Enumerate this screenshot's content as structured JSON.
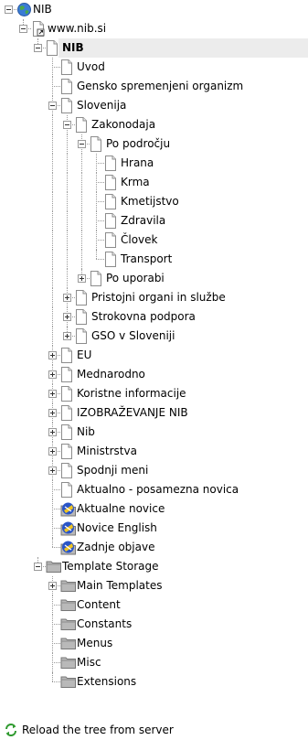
{
  "tree": [
    {
      "label": "NIB",
      "depth": 0,
      "exp": "minus",
      "icon": "globe-icon",
      "last": true
    },
    {
      "label": "www.nib.si",
      "depth": 1,
      "exp": "minus",
      "icon": "shortcut-page-icon",
      "last": true
    },
    {
      "label": "NIB",
      "depth": 2,
      "exp": "minus",
      "icon": "page-icon",
      "last": true,
      "bold": true,
      "selected": true
    },
    {
      "label": "Uvod",
      "depth": 3,
      "exp": "none",
      "icon": "page-icon",
      "last": false
    },
    {
      "label": "Gensko spremenjeni organizm",
      "depth": 3,
      "exp": "none",
      "icon": "page-icon",
      "last": false
    },
    {
      "label": "Slovenija",
      "depth": 3,
      "exp": "minus",
      "icon": "page-icon",
      "last": false
    },
    {
      "label": "Zakonodaja",
      "depth": 4,
      "exp": "minus",
      "icon": "page-icon",
      "last": false
    },
    {
      "label": "Po področju",
      "depth": 5,
      "exp": "minus",
      "icon": "page-icon",
      "last": false
    },
    {
      "label": "Hrana",
      "depth": 6,
      "exp": "none",
      "icon": "page-icon",
      "last": false
    },
    {
      "label": "Krma",
      "depth": 6,
      "exp": "none",
      "icon": "page-icon",
      "last": false
    },
    {
      "label": "Kmetijstvo",
      "depth": 6,
      "exp": "none",
      "icon": "page-icon",
      "last": false
    },
    {
      "label": "Zdravila",
      "depth": 6,
      "exp": "none",
      "icon": "page-icon",
      "last": false
    },
    {
      "label": "Človek",
      "depth": 6,
      "exp": "none",
      "icon": "page-icon",
      "last": false
    },
    {
      "label": "Transport",
      "depth": 6,
      "exp": "none",
      "icon": "page-icon",
      "last": true
    },
    {
      "label": "Po uporabi",
      "depth": 5,
      "exp": "plus",
      "icon": "page-icon",
      "last": true
    },
    {
      "label": "Pristojni organi in službe",
      "depth": 4,
      "exp": "plus",
      "icon": "page-icon",
      "last": false
    },
    {
      "label": "Strokovna podpora",
      "depth": 4,
      "exp": "plus",
      "icon": "page-icon",
      "last": false
    },
    {
      "label": "GSO v Sloveniji",
      "depth": 4,
      "exp": "plus",
      "icon": "page-icon",
      "last": true
    },
    {
      "label": "EU",
      "depth": 3,
      "exp": "plus",
      "icon": "page-icon",
      "last": false
    },
    {
      "label": "Mednarodno",
      "depth": 3,
      "exp": "plus",
      "icon": "page-icon",
      "last": false
    },
    {
      "label": "Koristne informacije",
      "depth": 3,
      "exp": "plus",
      "icon": "page-icon",
      "last": false
    },
    {
      "label": "IZOBRAŽEVANJE NIB",
      "depth": 3,
      "exp": "plus",
      "icon": "page-icon",
      "last": false
    },
    {
      "label": "Nib",
      "depth": 3,
      "exp": "plus",
      "icon": "page-icon",
      "last": false
    },
    {
      "label": "Ministrstva",
      "depth": 3,
      "exp": "plus",
      "icon": "page-icon",
      "last": false
    },
    {
      "label": "Spodnji meni",
      "depth": 3,
      "exp": "plus",
      "icon": "page-icon",
      "last": false
    },
    {
      "label": "Aktualno - posamezna novica",
      "depth": 3,
      "exp": "none",
      "icon": "page-icon",
      "last": false
    },
    {
      "label": "Aktualne novice",
      "depth": 3,
      "exp": "none",
      "icon": "news-folder-icon",
      "last": false
    },
    {
      "label": "Novice English",
      "depth": 3,
      "exp": "none",
      "icon": "news-folder-icon",
      "last": false
    },
    {
      "label": "Zadnje objave",
      "depth": 3,
      "exp": "none",
      "icon": "news-folder-icon",
      "last": true
    },
    {
      "label": "Template Storage",
      "depth": 2,
      "exp": "minus",
      "icon": "folder-icon",
      "last": true
    },
    {
      "label": "Main Templates",
      "depth": 3,
      "exp": "plus",
      "icon": "folder-icon",
      "last": false
    },
    {
      "label": "Content",
      "depth": 3,
      "exp": "none",
      "icon": "folder-icon",
      "last": false
    },
    {
      "label": "Constants",
      "depth": 3,
      "exp": "none",
      "icon": "folder-icon",
      "last": false
    },
    {
      "label": "Menus",
      "depth": 3,
      "exp": "none",
      "icon": "folder-icon",
      "last": false
    },
    {
      "label": "Misc",
      "depth": 3,
      "exp": "none",
      "icon": "folder-icon",
      "last": false
    },
    {
      "label": "Extensions",
      "depth": 3,
      "exp": "none",
      "icon": "folder-icon",
      "last": true
    }
  ],
  "footer": {
    "reload_label": "Reload the tree from server",
    "reload_icon": "reload-icon"
  },
  "colors": {
    "selection": "#ececec",
    "connector": "#9a9a9a",
    "folder": "#b9b9b9",
    "globe": "#4aa84a",
    "reload": "#2f9a2f"
  }
}
